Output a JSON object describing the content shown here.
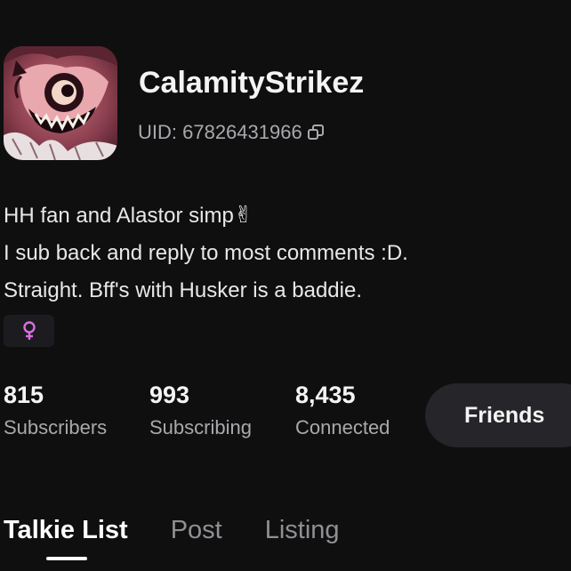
{
  "profile": {
    "username": "CalamityStrikez",
    "uid_text": "UID: 67826431966",
    "bio": [
      "HH fan and Alastor simp",
      "I sub back and reply to most comments :D.",
      "Straight. Bff's with Husker is a baddie."
    ],
    "bio_emoji": "✌",
    "gender_icon": "female-icon"
  },
  "stats": [
    {
      "value": "815",
      "label": "Subscribers"
    },
    {
      "value": "993",
      "label": "Subscribing"
    },
    {
      "value": "8,435",
      "label": "Connected"
    }
  ],
  "actions": {
    "friends_label": "Friends"
  },
  "tabs": [
    {
      "label": "Talkie List",
      "active": true
    },
    {
      "label": "Post",
      "active": false
    },
    {
      "label": "Listing",
      "active": false
    }
  ],
  "colors": {
    "background": "#0f0f10",
    "muted_text": "#a9a9ad",
    "chip_bg": "#1c1c20",
    "gender_accent": "#d86ee0",
    "button_bg": "#26262a"
  }
}
